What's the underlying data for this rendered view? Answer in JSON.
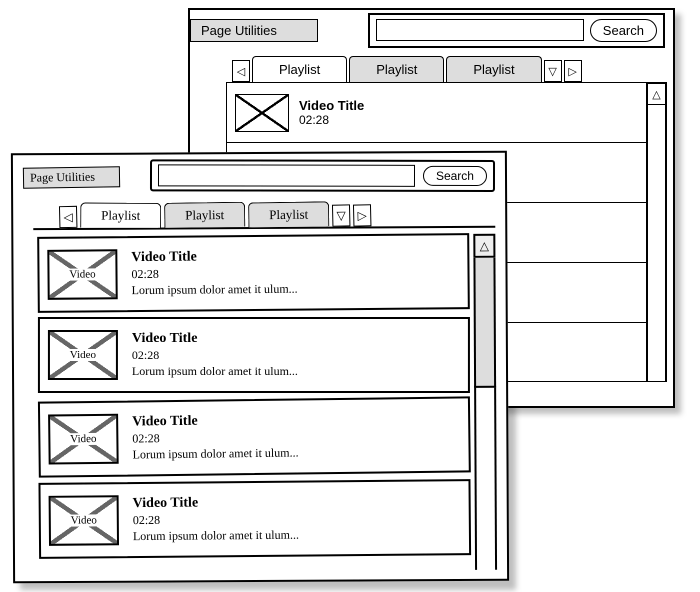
{
  "back": {
    "page_utilities": "Page Utilities",
    "search_button": "Search",
    "tabs": [
      "Playlist",
      "Playlist",
      "Playlist"
    ],
    "active_tab": 0,
    "rows": [
      {
        "title": "Video Title",
        "time": "02:28"
      }
    ]
  },
  "front": {
    "page_utilities": "Page Utilities",
    "search_button": "Search",
    "tabs": [
      "Playlist",
      "Playlist",
      "Playlist"
    ],
    "active_tab": 0,
    "thumb_label": "Video",
    "rows": [
      {
        "title": "Video Title",
        "time": "02:28",
        "desc": "Lorum ipsum dolor amet it ulum..."
      },
      {
        "title": "Video Title",
        "time": "02:28",
        "desc": "Lorum ipsum dolor amet it ulum..."
      },
      {
        "title": "Video Title",
        "time": "02:28",
        "desc": "Lorum ipsum dolor amet it ulum..."
      },
      {
        "title": "Video Title",
        "time": "02:28",
        "desc": "Lorum ipsum dolor amet it ulum..."
      }
    ]
  }
}
